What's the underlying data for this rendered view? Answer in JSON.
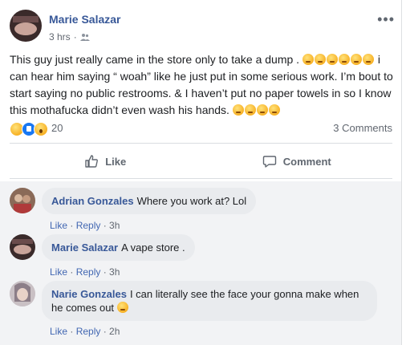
{
  "post": {
    "author": "Marie Salazar",
    "time": "3 hrs",
    "separator": "·",
    "more_icon": "more-horizontal-icon",
    "text_part1": "This guy just really came in the store only to take a dump .",
    "text_part2": "i can hear him saying “ woah” like he just put in some serious work. I’m bout to start saying no public restrooms. & I haven’t put no paper towels in so I know this mothafucka didn’t even wash his hands.",
    "reaction_count": "20",
    "comments_count": "3 Comments",
    "like_label": "Like",
    "comment_label": "Comment"
  },
  "comments": [
    {
      "name": "Adrian Gonzales",
      "text": "Where you work at? Lol",
      "like": "Like",
      "reply": "Reply",
      "time": "3h"
    },
    {
      "name": "Marie Salazar",
      "text": "A vape store .",
      "like": "Like",
      "reply": "Reply",
      "time": "3h"
    },
    {
      "name": "Narie Gonzales",
      "text": "I can literally see the face your gonna make when he comes out",
      "like": "Like",
      "reply": "Reply",
      "time": "2h"
    }
  ],
  "colors": {
    "name_blue": "#385898",
    "link_blue": "#4267b2",
    "like_blue": "#1877f2",
    "muted": "#616770"
  }
}
